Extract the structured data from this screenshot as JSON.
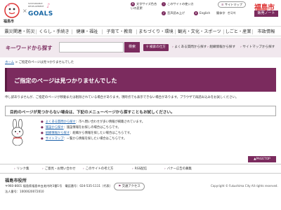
{
  "header": {
    "city_logo_name": "福島市",
    "cross": "×",
    "sdgs_small": "SUSTAINABLE DEVELOPMENT",
    "sdgs_goals": "GOALS",
    "links": {
      "font_size": "文字サイズ色合いの変更",
      "site_usage": "このサイトの使い方",
      "voice": "音声読み上げ",
      "english": "English",
      "simple_japanese": "簡体字",
      "korean": "한국어",
      "sitemap": "サイトマップ"
    },
    "brand_top": "福島市",
    "brand_sub": "販売ノート"
  },
  "nav": {
    "items": [
      "震災関連・防災",
      "くらし・手続き",
      "健康・福祉",
      "子育て・教育",
      "まちづくり・環境",
      "観光・文化・スポーツ",
      "しごと・産業",
      "市政情報"
    ]
  },
  "search": {
    "title": "キーワードから探す",
    "placeholder": "",
    "button": "検索",
    "quick_button": "検索の仕方",
    "links": [
      "よくある質問から探す",
      "組織情報から探す",
      "サイトマップから探す"
    ]
  },
  "breadcrumb": {
    "home": "ホーム",
    "sep": " > ",
    "current": "ご指定のページは見つかりませんでした"
  },
  "error": {
    "title": "ご指定のページは見つかりませんでした",
    "apology": "申し訳ありませんが、ご指定のページが移動または削除されている場合があります。現時点でも表示できない場合があります。ブラウザで再読み込みをお試しください。",
    "guide": "目的のページが見つからない場合は、下記のメニューページから探すこともお試しください。"
  },
  "menu": {
    "items": [
      {
        "link": "よくある質問から探す",
        "desc": "：市へ問い合わせが多い情報が掲載されています。"
      },
      {
        "link": "施設から探す",
        "desc": "：施設情報をお探しの場合はこちらです。"
      },
      {
        "link": "組織情報から探す",
        "desc": "：組織から情報を探したい場合はこちらです。"
      },
      {
        "link": "サイトマップ",
        "desc": "：一覧から情報を探したい場合はこちらです。"
      }
    ]
  },
  "pagetop": "▲PAGETOP",
  "footer": {
    "links": [
      "リンク集",
      "ご意見・お問い合わせ",
      "このサイトの考え方",
      "RSS配信",
      "バナー広告の募集"
    ],
    "office": "福島市役所",
    "address": "〒960-8601 福島県福島市五老内町3番1号　電話番号：024-535-1111（代表）",
    "corp_number": "法人番号：1000020072010",
    "access": "交通アクセス",
    "copyright": "Copyright © Fukushima City All rights reserved."
  },
  "colors": {
    "brand": "#7b2b5e",
    "link": "#1a5fa8",
    "search_band": "#f1e8ee"
  }
}
